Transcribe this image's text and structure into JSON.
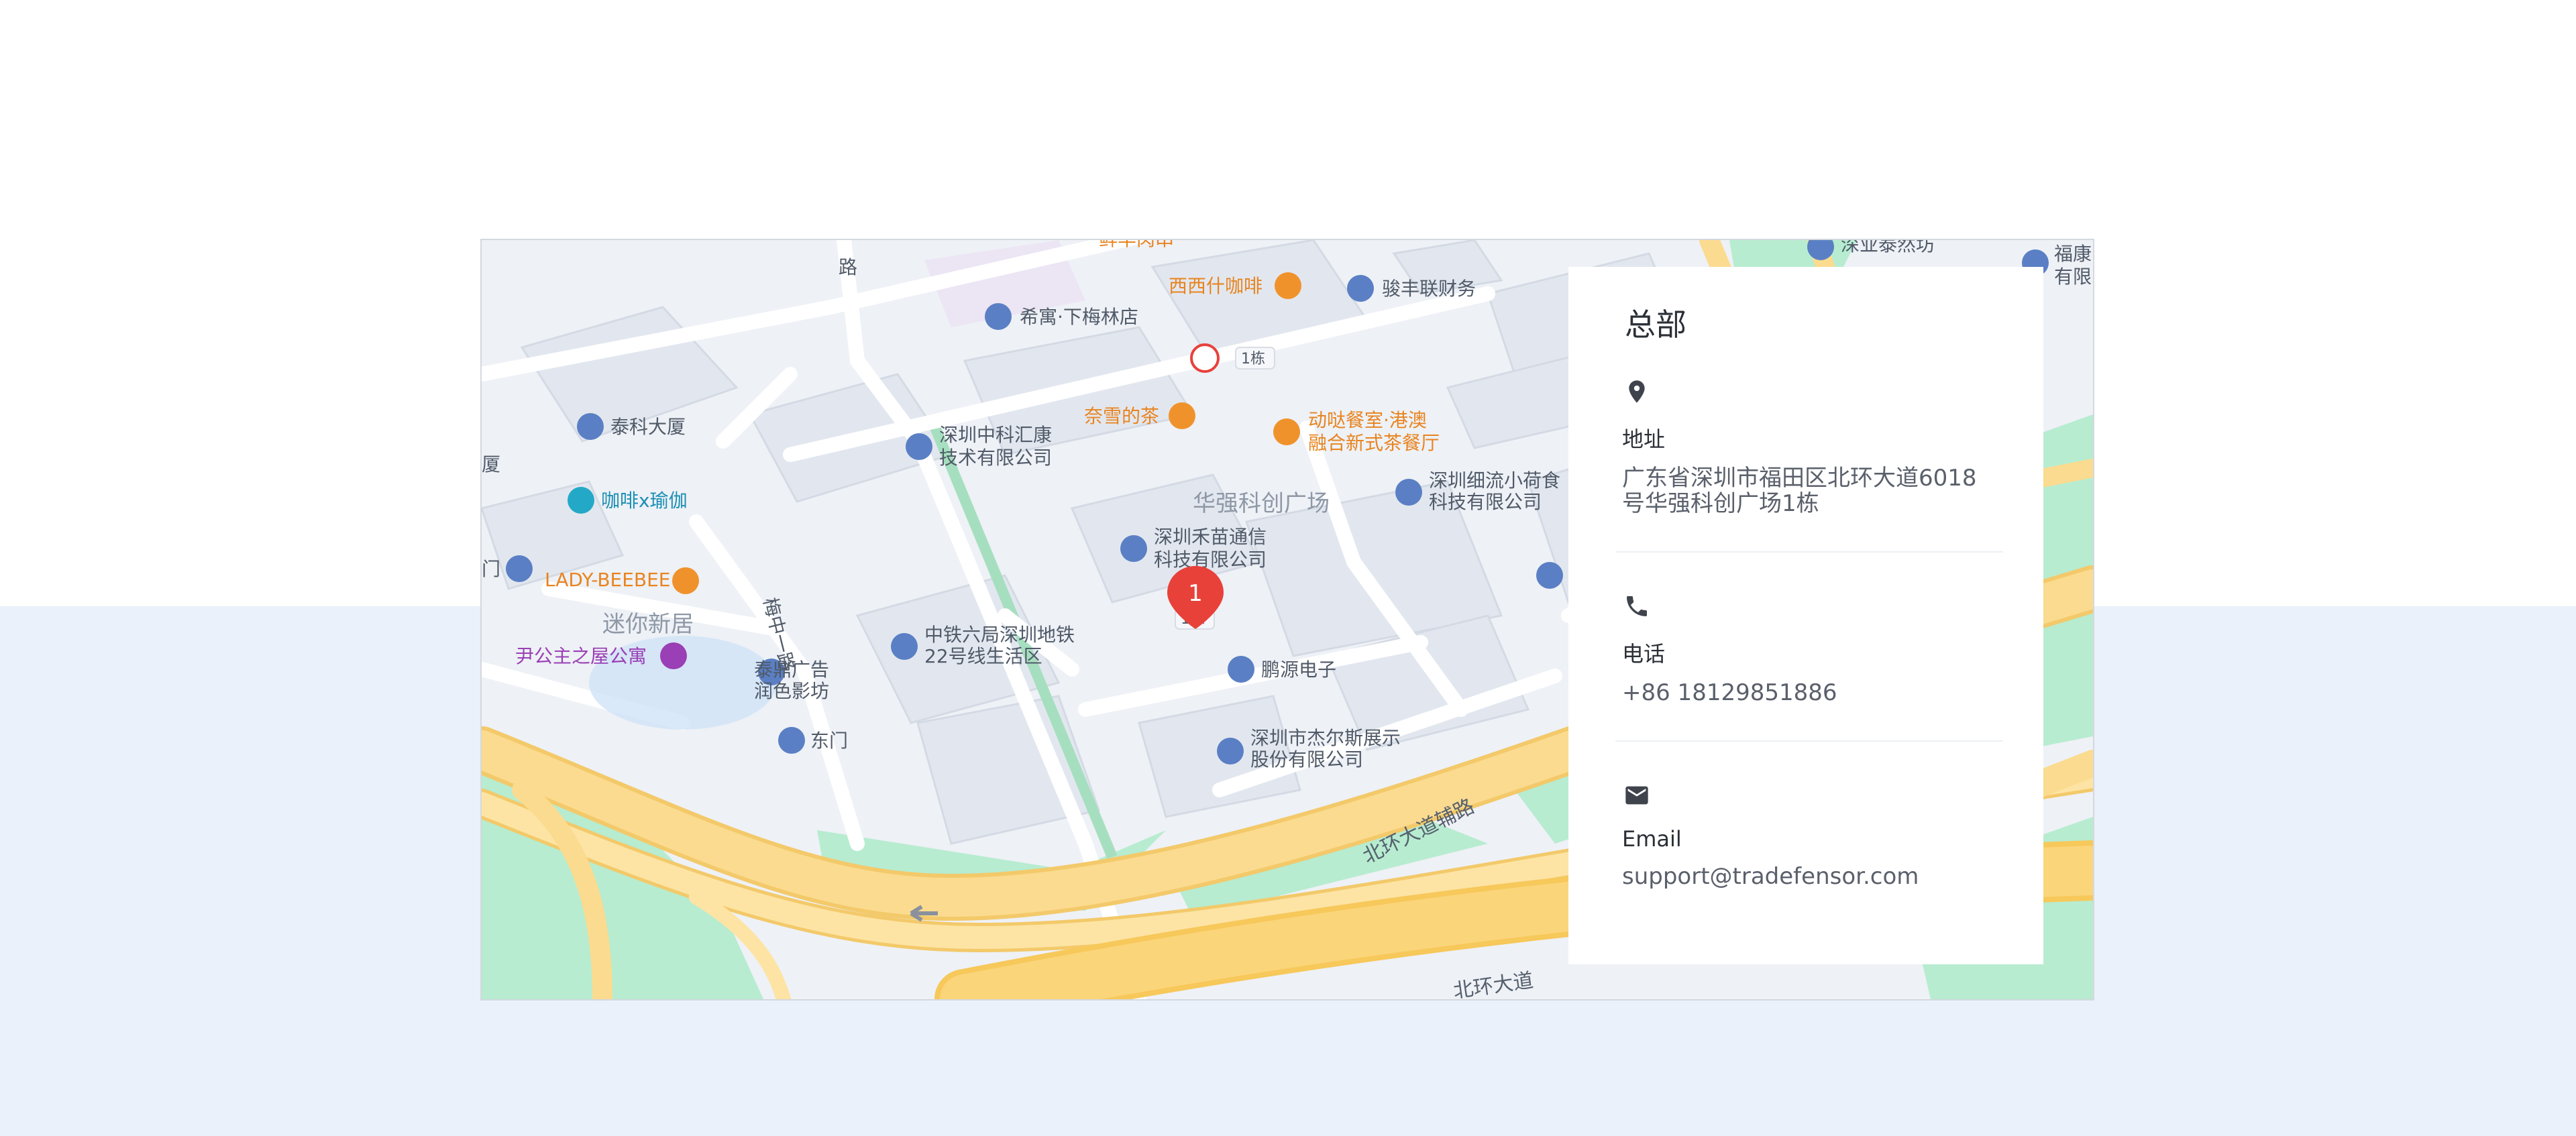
{
  "map": {
    "pin_number": "1",
    "labels": {
      "xiyu": "希寓·下梅林店",
      "xixi": "西西什咖啡",
      "junfeng": "骏丰联财务",
      "taike": "泰科大厦",
      "coffee_yoga": "咖啡x瑜伽",
      "zhongke": "深圳中科汇康",
      "zhongke2": "技术有限公司",
      "naixue": "奈雪的茶",
      "dongtai": "动哒餐室·港澳",
      "dongtai2": "融合新式茶餐厅",
      "huaqiang": "华强科创广场",
      "xiliu": "深圳细流小荷食",
      "xiliu2": "科技有限公司",
      "hemiao": "深圳禾苗通信",
      "hemiao2": "科技有限公司",
      "lady": "LADY-BEEBEE",
      "mini": "迷你新居",
      "yingong": "尹公主之屋公寓",
      "meizhong": "梅中一路",
      "zhongtie": "中铁六局深圳地铁",
      "zhongtie2": "22号线生活区",
      "pengyuan": "鹏源电子",
      "taiding": "泰鼎广告",
      "taiding2": "润色影坊",
      "dongmen": "东门",
      "jieersi": "深圳市杰尔斯展示",
      "jieersi2": "股份有限公司",
      "beihuan_aux": "北环大道辅路",
      "beihuan": "北环大道",
      "building1": "1栋",
      "shenye": "深业泰然坊",
      "fukang": "福康",
      "fukang2": "有限",
      "xiamen": "厦",
      "men": "门",
      "lu": "路",
      "xianrou": "鲜羊肉串"
    }
  },
  "card": {
    "title": "总部",
    "address": {
      "label": "地址",
      "value": "广东省深圳市福田区北环大道6018号华强科创广场1栋",
      "icon": "location-pin-icon"
    },
    "phone": {
      "label": "电话",
      "value": "+86 18129851886",
      "icon": "phone-icon"
    },
    "email": {
      "label": "Email",
      "value": "support@tradefensor.com",
      "icon": "mail-icon"
    }
  },
  "colors": {
    "background_band": "#eaf1fb",
    "map_base": "#eef1f6",
    "map_green": "#b7ecd0",
    "map_road_yellow": "#fbdb8f",
    "pin_red": "#e8413a",
    "poi_blue": "#5a7fc4",
    "poi_orange": "#f0922b"
  }
}
